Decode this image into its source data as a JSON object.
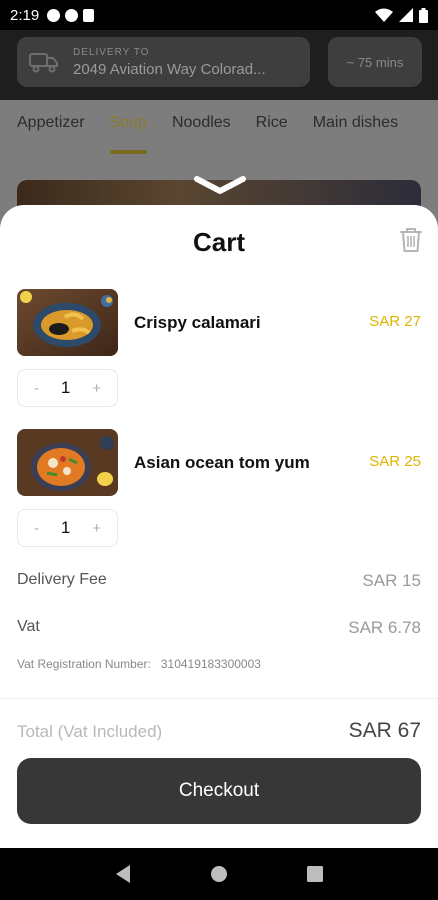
{
  "status_bar": {
    "time": "2:19"
  },
  "header": {
    "delivery_label": "DELIVERY TO",
    "delivery_address": "2049 Aviation Way Colorad...",
    "eta": "~ 75 mins"
  },
  "tabs": [
    {
      "label": "Appetizer"
    },
    {
      "label": "Soup"
    },
    {
      "label": "Noodles"
    },
    {
      "label": "Rice"
    },
    {
      "label": "Main dishes"
    }
  ],
  "cart": {
    "title": "Cart",
    "items": [
      {
        "name": "Crispy calamari",
        "price": "SAR 27",
        "qty": "1",
        "minus": "-",
        "plus": "+"
      },
      {
        "name": "Asian ocean tom yum",
        "price": "SAR 25",
        "qty": "1",
        "minus": "-",
        "plus": "+"
      }
    ],
    "delivery_fee_label": "Delivery Fee",
    "delivery_fee_value": "SAR 15",
    "vat_label": "Vat",
    "vat_value": "SAR 6.78",
    "vat_reg_label": "Vat Registration Number:",
    "vat_reg_number": "310419183300003",
    "total_label": "Total (Vat Included)",
    "total_value": "SAR 67",
    "checkout_label": "Checkout"
  },
  "colors": {
    "accent": "#e0b400",
    "button": "#373737"
  },
  "icons": [
    "truck-icon",
    "chevron-down-icon",
    "trash-icon",
    "back-icon",
    "home-icon",
    "recents-icon"
  ]
}
